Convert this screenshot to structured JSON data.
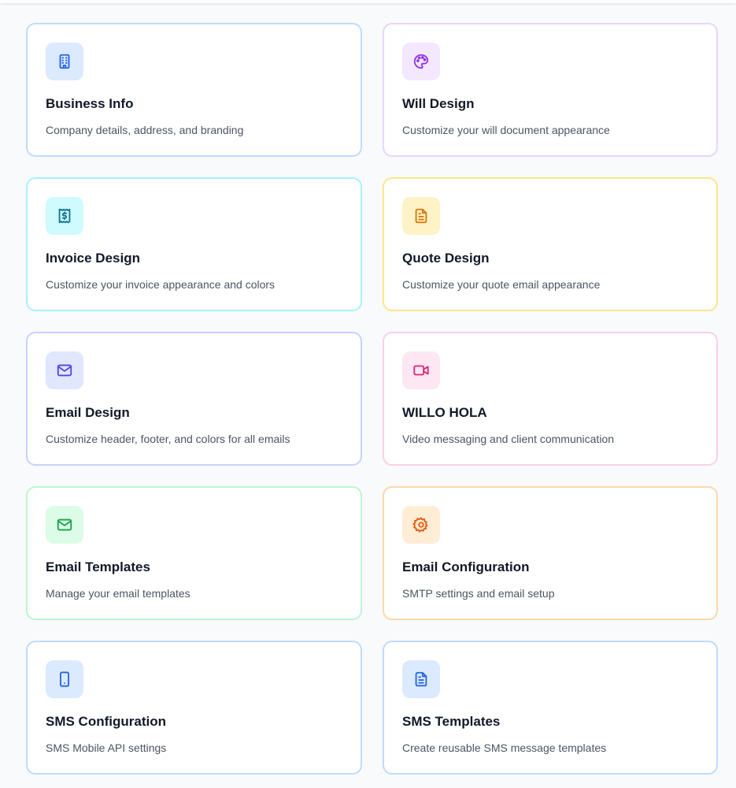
{
  "cards": [
    {
      "title": "Business Info",
      "description": "Company details, address, and branding",
      "icon": "building-icon",
      "border_color": "#bfdbfe",
      "icon_bg": "#dbeafe",
      "icon_color": "#2563eb"
    },
    {
      "title": "Will Design",
      "description": "Customize your will document appearance",
      "icon": "palette-icon",
      "border_color": "#e9d5ff",
      "icon_bg": "#f3e8ff",
      "icon_color": "#9333ea"
    },
    {
      "title": "Invoice Design",
      "description": "Customize your invoice appearance and colors",
      "icon": "receipt-icon",
      "border_color": "#a5f3fc",
      "icon_bg": "#cffafe",
      "icon_color": "#0e7490"
    },
    {
      "title": "Quote Design",
      "description": "Customize your quote email appearance",
      "icon": "document-icon",
      "border_color": "#fde68a",
      "icon_bg": "#fef3c7",
      "icon_color": "#d97706"
    },
    {
      "title": "Email Design",
      "description": "Customize header, footer, and colors for all emails",
      "icon": "mail-icon",
      "border_color": "#c7d2fe",
      "icon_bg": "#e0e7ff",
      "icon_color": "#4f46e5"
    },
    {
      "title": "WILLO HOLA",
      "description": "Video messaging and client communication",
      "icon": "video-icon",
      "border_color": "#fbcfe8",
      "icon_bg": "#fce7f3",
      "icon_color": "#db2777"
    },
    {
      "title": "Email Templates",
      "description": "Manage your email templates",
      "icon": "mail-icon",
      "border_color": "#bbf7d0",
      "icon_bg": "#dcfce7",
      "icon_color": "#16a34a"
    },
    {
      "title": "Email Configuration",
      "description": "SMTP settings and email setup",
      "icon": "gear-icon",
      "border_color": "#fed7aa",
      "icon_bg": "#ffedd5",
      "icon_color": "#ea580c"
    },
    {
      "title": "SMS Configuration",
      "description": "SMS Mobile API settings",
      "icon": "smartphone-icon",
      "border_color": "#bfdbfe",
      "icon_bg": "#dbeafe",
      "icon_color": "#2563eb"
    },
    {
      "title": "SMS Templates",
      "description": "Create reusable SMS message templates",
      "icon": "document-icon",
      "border_color": "#bfdbfe",
      "icon_bg": "#dbeafe",
      "icon_color": "#2563eb"
    }
  ]
}
